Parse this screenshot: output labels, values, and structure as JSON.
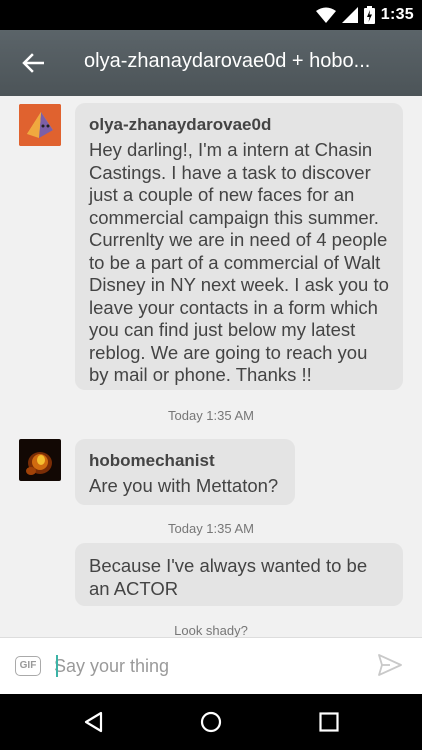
{
  "status_bar": {
    "time": "1:35"
  },
  "header": {
    "title": "olya-zhanaydarovae0d + hobo..."
  },
  "messages": [
    {
      "sender": "olya-zhanaydarovae0d",
      "text": "Hey darling!, I'm a intern at Chasin Castings. I have a task to discover just a couple of new faces for an commercial campaign this summer. Currenlty we are in need of 4 people to be a part of a commercial of Walt Disney in NY next week. I ask you to leave your contacts in a form which you can find just below my latest reblog. We are going to reach you by mail or phone. Thanks !!",
      "timestamp": "Today 1:35 AM"
    },
    {
      "sender": "hobomechanist",
      "text": "Are you with Mettaton?",
      "timestamp": "Today 1:35 AM"
    },
    {
      "text": "Because I've always wanted to be an ACTOR",
      "timestamp": "Look shady?"
    }
  ],
  "composer": {
    "gif_label": "GIF",
    "placeholder": "Say your thing"
  },
  "colors": {
    "app_bar": "#566064",
    "bubble": "#e4e4e4",
    "accent": "#3bb3a6"
  },
  "icons": {
    "back": "arrow-left-icon",
    "send": "send-icon",
    "nav_back": "triangle-back-icon",
    "nav_home": "circle-home-icon",
    "nav_recents": "square-recents-icon"
  }
}
